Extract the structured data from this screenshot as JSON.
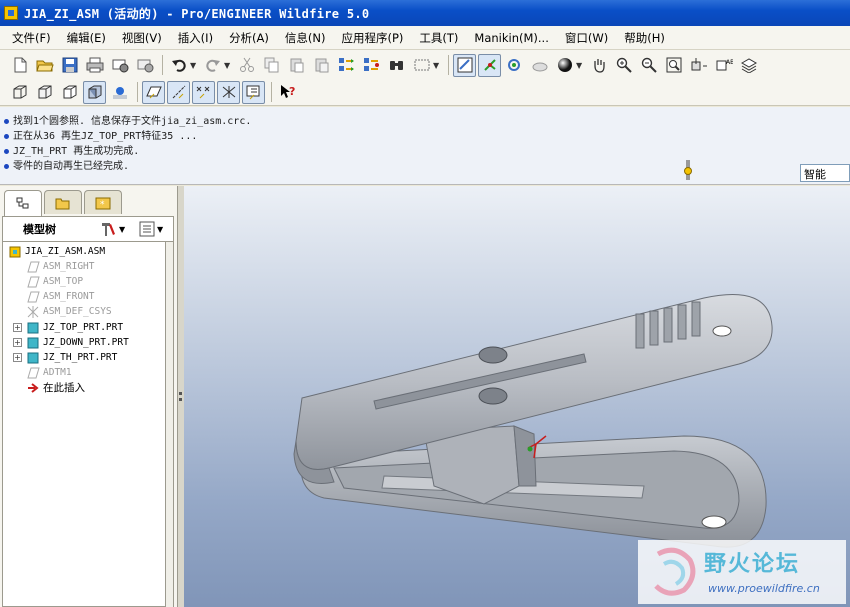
{
  "window": {
    "title": "JIA_ZI_ASM (活动的) - Pro/ENGINEER Wildfire 5.0"
  },
  "menu": [
    "文件(F)",
    "编辑(E)",
    "视图(V)",
    "插入(I)",
    "分析(A)",
    "信息(N)",
    "应用程序(P)",
    "工具(T)",
    "Manikin(M)...",
    "窗口(W)",
    "帮助(H)"
  ],
  "toolbar": {
    "row1": [
      "new-icon",
      "open-icon",
      "save-icon",
      "print-icon",
      "send-email-icon",
      "send-link-icon",
      "undo-icon",
      "redo-icon",
      "cut-icon",
      "copy-icon",
      "paste-icon",
      "paste-special-icon",
      "regenerate-icon",
      "regen-manager-icon",
      "find-icon",
      "select-box-icon",
      "sketch-view-icon",
      "spin-center-icon",
      "named-view-icon",
      "appearance-icon",
      "render-icon",
      "pan-hand-icon",
      "zoom-in-icon",
      "zoom-out-icon",
      "refit-icon",
      "reorient-icon",
      "saved-views-icon",
      "layers-icon"
    ],
    "row2": [
      "wireframe-icon",
      "hidden-line-icon",
      "no-hidden-icon",
      "shading-icon",
      "enhanced-realism-icon",
      "datum-plane-display-icon",
      "datum-axis-display-icon",
      "datum-point-display-icon",
      "csys-display-icon",
      "annotation-display-icon",
      "context-help-icon"
    ]
  },
  "messages": [
    "找到1个圆参照. 信息保存于文件jia_zi_asm.crc.",
    "正在从36 再生JZ_TOP_PRT特征35 ...",
    "JZ_TH_PRT 再生成功完成.",
    "零件的自动再生已经完成."
  ],
  "filter": {
    "value": "智能"
  },
  "model_tree": {
    "title": "模型树",
    "nodes": [
      {
        "label": "JIA_ZI_ASM.ASM",
        "kind": "assembly",
        "dim": false,
        "expandable": false
      },
      {
        "label": "ASM_RIGHT",
        "kind": "datum-plane",
        "dim": true,
        "expandable": false
      },
      {
        "label": "ASM_TOP",
        "kind": "datum-plane",
        "dim": true,
        "expandable": false
      },
      {
        "label": "ASM_FRONT",
        "kind": "datum-plane",
        "dim": true,
        "expandable": false
      },
      {
        "label": "ASM_DEF_CSYS",
        "kind": "csys",
        "dim": true,
        "expandable": false
      },
      {
        "label": "JZ_TOP_PRT.PRT",
        "kind": "part",
        "dim": false,
        "expandable": true
      },
      {
        "label": "JZ_DOWN_PRT.PRT",
        "kind": "part",
        "dim": false,
        "expandable": true
      },
      {
        "label": "JZ_TH_PRT.PRT",
        "kind": "part",
        "dim": false,
        "expandable": true
      },
      {
        "label": "ADTM1",
        "kind": "datum-plane",
        "dim": true,
        "expandable": false
      },
      {
        "label": "在此插入",
        "kind": "insert-here",
        "dim": false,
        "expandable": false
      }
    ]
  },
  "watermark": {
    "name": "野火论坛",
    "url": "www.proewildfire.cn"
  },
  "colors": {
    "titlebar": "#0a4fc7",
    "part_icon": "#3fb6c8",
    "insert_arrow": "#c81d1d",
    "model": "#b8bcc2"
  }
}
